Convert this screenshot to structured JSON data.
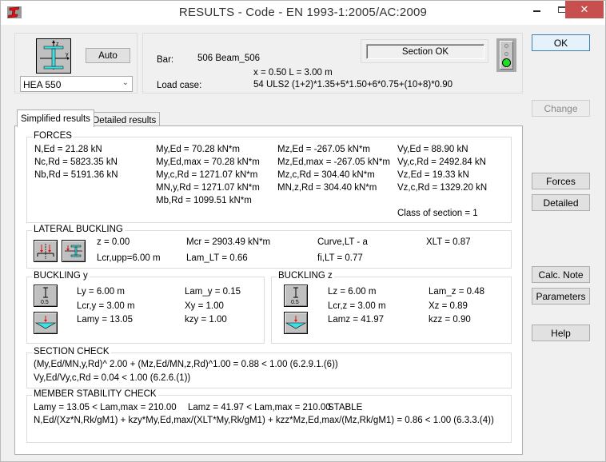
{
  "window": {
    "title": "RESULTS - Code - EN 1993-1:2005/AC:2009",
    "icons": {
      "app": "steel-section-app-icon",
      "minimize": "minimize-icon",
      "maximize": "maximize-icon",
      "close": "close-icon"
    }
  },
  "section_selector": {
    "preview_icon": "i-section-axes-icon",
    "auto_label": "Auto",
    "section_value": "HEA 550"
  },
  "bar_info": {
    "bar_label": "Bar:",
    "bar_value": "506  Beam_506",
    "position": "x = 0.50 L = 3.00 m",
    "load_case_label": "Load case:",
    "load_case_value": "54 ULS2  (1+2)*1.35+5*1.50+6*0.75+(10+8)*0.90",
    "status": "Section OK",
    "traffic_light": {
      "state": "green",
      "color": "#1fe01f"
    }
  },
  "buttons": {
    "ok": "OK",
    "change": "Change",
    "forces": "Forces",
    "detailed": "Detailed",
    "calc_note": "Calc. Note",
    "parameters": "Parameters",
    "help": "Help"
  },
  "tabs": [
    {
      "label": "Simplified results",
      "active": true
    },
    {
      "label": "Detailed results",
      "active": false
    }
  ],
  "forces": {
    "title": "FORCES",
    "col1": [
      "N,Ed = 21.28 kN",
      "Nc,Rd = 5823.35 kN",
      "Nb,Rd = 5191.36 kN"
    ],
    "col2": [
      "My,Ed = 70.28 kN*m",
      "My,Ed,max = 70.28 kN*m",
      "My,c,Rd = 1271.07 kN*m",
      "MN,y,Rd = 1271.07 kN*m",
      "Mb,Rd = 1099.51 kN*m"
    ],
    "col3": [
      "Mz,Ed = -267.05 kN*m",
      "Mz,Ed,max = -267.05 kN*m",
      "Mz,c,Rd = 304.40 kN*m",
      "MN,z,Rd = 304.40 kN*m"
    ],
    "col4": [
      "Vy,Ed = 88.90 kN",
      "Vy,c,Rd = 2492.84 kN",
      "Vz,Ed = 19.33 kN",
      "Vz,c,Rd = 1329.20 kN"
    ],
    "class_of_section": "Class of section = 1"
  },
  "lateral_buckling": {
    "title": "LATERAL BUCKLING",
    "icons": [
      "load-position-icon",
      "section-load-level-icon"
    ],
    "z": "z = 0.00",
    "lcr_upp": "Lcr,upp=6.00 m",
    "mcr": "Mcr = 2903.49 kN*m",
    "lam_lt": "Lam_LT = 0.66",
    "curve": "Curve,LT - a",
    "fi_lt": "fi,LT = 0.77",
    "xlt": "XLT = 0.87"
  },
  "buckling_y": {
    "title": "BUCKLING y",
    "icons": [
      "buckling-length-coefficient-icon",
      "load-diagram-icon"
    ],
    "coef_label": "0.5",
    "l": "Ly = 6.00 m",
    "lcr": "Lcr,y = 3.00 m",
    "lam": "Lamy = 13.05",
    "lam_rel": "Lam_y = 0.15",
    "x": "Xy = 1.00",
    "k": "kzy = 1.00"
  },
  "buckling_z": {
    "title": "BUCKLING z",
    "icons": [
      "buckling-length-coefficient-icon",
      "load-diagram-icon"
    ],
    "coef_label": "0.5",
    "l": "Lz = 6.00 m",
    "lcr": "Lcr,z = 3.00 m",
    "lam": "Lamz = 41.97",
    "lam_rel": "Lam_z = 0.48",
    "x": "Xz = 0.89",
    "k": "kzz = 0.90"
  },
  "section_check": {
    "title": "SECTION CHECK",
    "line1": "(My,Ed/MN,y,Rd)^ 2.00 + (Mz,Ed/MN,z,Rd)^1.00 = 0.88 < 1.00   (6.2.9.1.(6))",
    "line2": "Vy,Ed/Vy,c,Rd = 0.04 < 1.00   (6.2.6.(1))"
  },
  "member_stability_check": {
    "title": "MEMBER STABILITY CHECK",
    "lamy": "Lamy = 13.05 < Lam,max = 210.00",
    "lamz": "Lamz = 41.97 < Lam,max = 210.00",
    "status": "STABLE",
    "line2": "N,Ed/(Xz*N,Rk/gM1) + kzy*My,Ed,max/(XLT*My,Rk/gM1) + kzz*Mz,Ed,max/(Mz,Rk/gM1) = 0.86 < 1.00   (6.3.3.(4))"
  }
}
